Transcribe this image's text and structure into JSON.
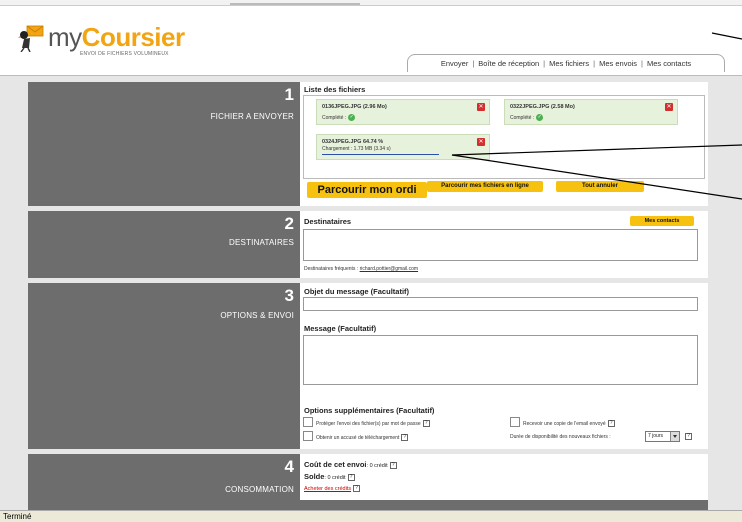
{
  "logo": {
    "brand_prefix": "my",
    "brand_accent": "Coursier",
    "tagline": "ENVOI DE FICHIERS VOLUMINEUX"
  },
  "nav": {
    "items": [
      "Envoyer",
      "Boîte de réception",
      "Mes fichiers",
      "Mes envois",
      "Mes contacts"
    ],
    "separator": "|"
  },
  "sections": [
    {
      "number": "1",
      "label": "FICHIER A ENVOYER"
    },
    {
      "number": "2",
      "label": "DESTINATAIRES"
    },
    {
      "number": "3",
      "label": "OPTIONS & ENVOI"
    },
    {
      "number": "4",
      "label": "CONSOMMATION"
    }
  ],
  "files": {
    "title": "Liste des fichiers",
    "items": [
      {
        "name": "0136JPEG.JPG  (2.96 Mo)",
        "status": "Complété :",
        "state": "complete"
      },
      {
        "name": "0322JPEG.JPG  (2.58 Mo)",
        "status": "Complété :",
        "state": "complete"
      },
      {
        "name": "0324JPEG.JPG   64.74 %",
        "status": "Chargement : 1.73 MB (3.34 s)",
        "state": "uploading",
        "progress_percent": 64.74
      }
    ],
    "buttons": {
      "browse": "Parcourir mon ordi",
      "browse_online": "Parcourir mes fichiers en ligne",
      "cancel_all": "Tout annuler"
    }
  },
  "recipients": {
    "title": "Destinataires",
    "contacts_button": "Mes contacts",
    "frequent_label": "Destinataires fréquents :",
    "frequent_email": "richard.pottier@gmail.com"
  },
  "options": {
    "subject_label": "Objet du message (Facultatif)",
    "message_label": "Message (Facultatif)",
    "extra_label": "Options supplémentaires (Facultatif)",
    "opt_password": "Protéger l'envoi des fichier(s) par mot de passe",
    "opt_receipt": "Obtenir un accusé de téléchargement",
    "opt_copy": "Recevoir une copie de l'email envoyé",
    "availability_label": "Durée de disponibilité des nouveaux fichiers :",
    "availability_value": "7 jours",
    "help_glyph": "?"
  },
  "consumption": {
    "cost_label": "Coût de cet envoi",
    "cost_value": ": 0 crédit",
    "balance_label": "Solde",
    "balance_value": ": 0 crédit",
    "buy_link": "Acheter des crédits"
  },
  "statusbar": {
    "text": "Terminé"
  },
  "colors": {
    "accent": "#f2a413",
    "button": "#f6c10f",
    "section_bg": "#6d6d6d",
    "file_bg": "#e7f2dc",
    "delete": "#d32f2f",
    "ok": "#4caf50",
    "link": "#cc0000"
  }
}
